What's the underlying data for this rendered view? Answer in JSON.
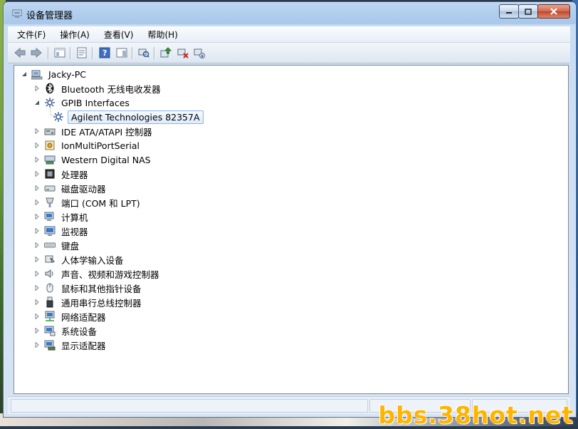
{
  "window": {
    "title": "设备管理器"
  },
  "menu": [
    "文件(F)",
    "操作(A)",
    "查看(V)",
    "帮助(H)"
  ],
  "tree": {
    "root": "Jacky-PC",
    "items": [
      {
        "label": "Bluetooth 无线电收发器",
        "icon": "bluetooth-icon",
        "expanded": false
      },
      {
        "label": "GPIB Interfaces",
        "icon": "gpib-icon",
        "expanded": true
      },
      {
        "label": "Agilent Technologies 82357A",
        "icon": "gpib-device-icon",
        "child": true,
        "selected": true
      },
      {
        "label": "IDE ATA/ATAPI 控制器",
        "icon": "ide-controller-icon",
        "expanded": false
      },
      {
        "label": "IonMultiPortSerial",
        "icon": "serial-card-icon",
        "expanded": false
      },
      {
        "label": "Western Digital NAS",
        "icon": "nas-icon",
        "expanded": false
      },
      {
        "label": "处理器",
        "icon": "processor-icon",
        "expanded": false
      },
      {
        "label": "磁盘驱动器",
        "icon": "disk-drive-icon",
        "expanded": false
      },
      {
        "label": "端口 (COM 和 LPT)",
        "icon": "port-icon",
        "expanded": false
      },
      {
        "label": "计算机",
        "icon": "computer-icon",
        "expanded": false
      },
      {
        "label": "监视器",
        "icon": "monitor-icon",
        "expanded": false
      },
      {
        "label": "键盘",
        "icon": "keyboard-icon",
        "expanded": false
      },
      {
        "label": "人体学输入设备",
        "icon": "hid-icon",
        "expanded": false
      },
      {
        "label": "声音、视频和游戏控制器",
        "icon": "audio-icon",
        "expanded": false
      },
      {
        "label": "鼠标和其他指针设备",
        "icon": "mouse-icon",
        "expanded": false
      },
      {
        "label": "通用串行总线控制器",
        "icon": "usb-icon",
        "expanded": false
      },
      {
        "label": "网络适配器",
        "icon": "network-adapter-icon",
        "expanded": false
      },
      {
        "label": "系统设备",
        "icon": "system-device-icon",
        "expanded": false
      },
      {
        "label": "显示适配器",
        "icon": "display-adapter-icon",
        "expanded": false
      }
    ]
  },
  "watermark": "bbs.38hot.net"
}
